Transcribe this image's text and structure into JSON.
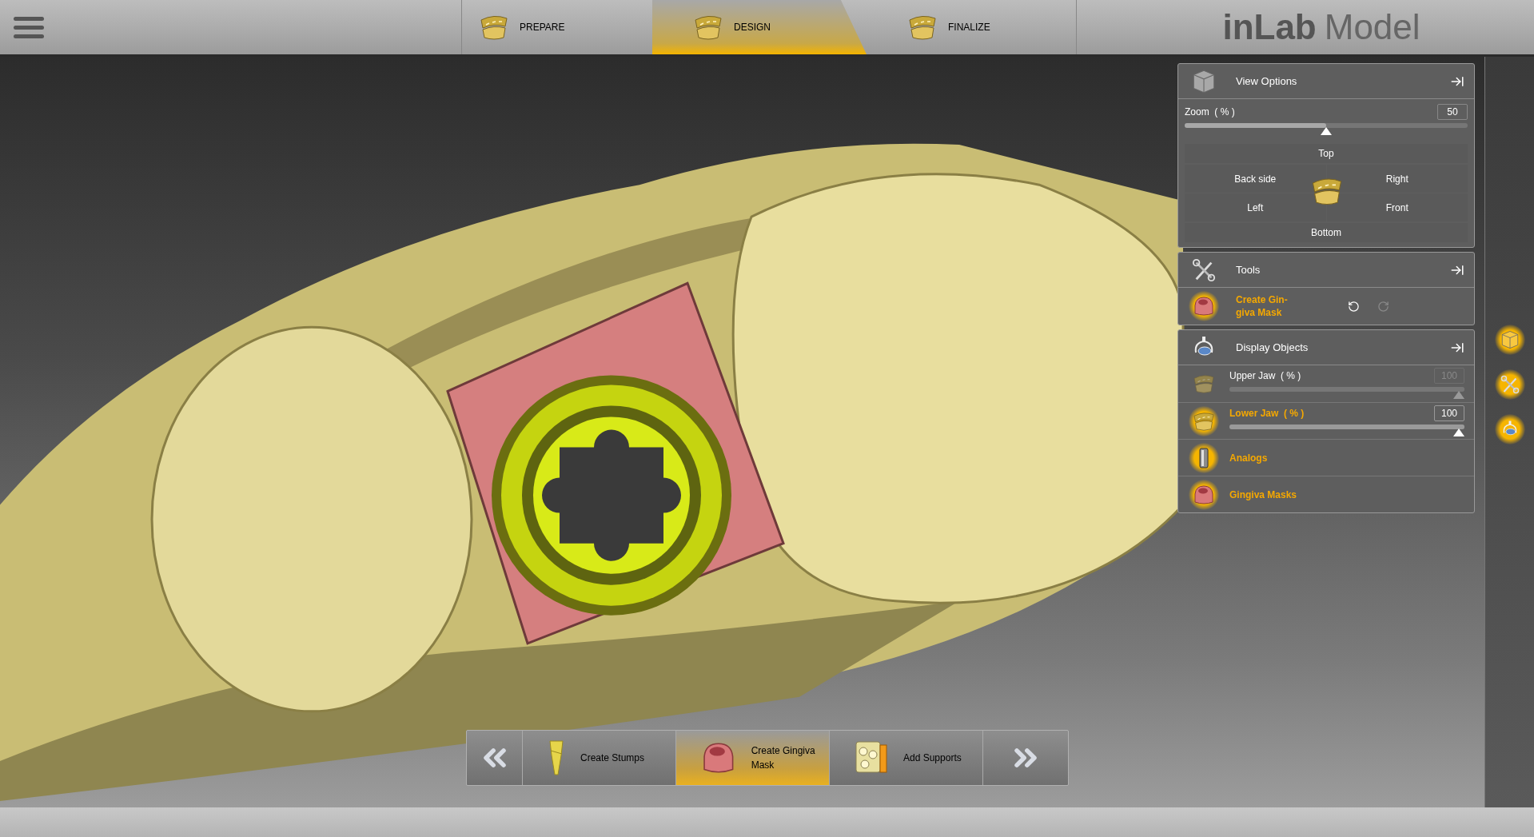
{
  "workflow_tabs": [
    {
      "label": "PREPARE",
      "selected": false
    },
    {
      "label": "DESIGN",
      "selected": true
    },
    {
      "label": "FINALIZE",
      "selected": false
    }
  ],
  "app_title": {
    "brand": "inLab",
    "product": "Model"
  },
  "view_options": {
    "title": "View Options",
    "zoom": {
      "label": "Zoom  ( % )",
      "value": "50",
      "level": 0.5
    },
    "views": [
      "Top",
      "Back side",
      "Right",
      "Left",
      "Front",
      "Bottom"
    ]
  },
  "tools": {
    "title": "Tools",
    "active_tool": [
      "Create Gin-",
      "giva Mask"
    ],
    "undo_enabled": true,
    "redo_enabled": false
  },
  "display_objects": {
    "title": "Display Objects",
    "items": [
      {
        "kind": "slider",
        "label": "Upper Jaw  ( % )",
        "value": "100",
        "level": 1,
        "active": false
      },
      {
        "kind": "slider",
        "label": "Lower Jaw  ( % )",
        "value": "100",
        "level": 1,
        "active": true
      },
      {
        "kind": "toggle",
        "label": "Analogs",
        "active": true
      },
      {
        "kind": "toggle",
        "label": "Gingiva Masks",
        "active": true
      }
    ]
  },
  "steps": [
    {
      "label": "Create Stumps",
      "selected": false
    },
    {
      "label": "Create Gingiva Mask",
      "selected": true
    },
    {
      "label": "Add Supports",
      "selected": false
    }
  ]
}
